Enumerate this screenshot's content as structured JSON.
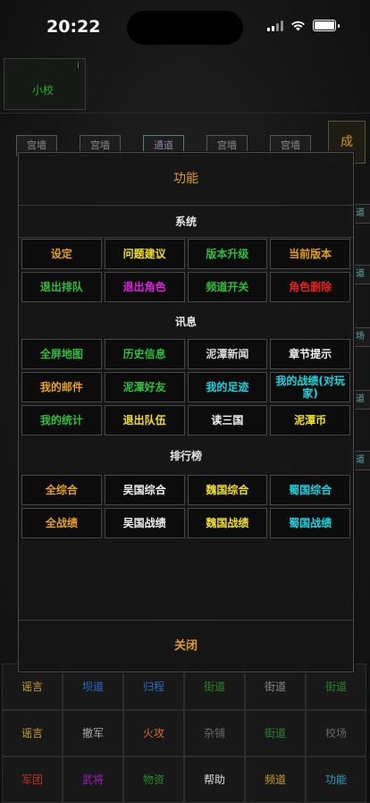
{
  "status": {
    "time": "20:22"
  },
  "player": {
    "name": "小校",
    "info": "i"
  },
  "roads": [
    "宫墙",
    "宫墙",
    "通道",
    "宫墙",
    "宫墙"
  ],
  "corner": "成",
  "side_right": [
    "道",
    "道",
    "场",
    "道",
    "道"
  ],
  "modal": {
    "title": "功能",
    "sections": [
      {
        "label": "系统",
        "buttons": [
          {
            "label": "设定",
            "color": "#e6a21a"
          },
          {
            "label": "问题建议",
            "color": "#f0e020"
          },
          {
            "label": "版本升级",
            "color": "#2fbf3a"
          },
          {
            "label": "当前版本",
            "color": "#e6a21a"
          },
          {
            "label": "退出排队",
            "color": "#2fbf3a"
          },
          {
            "label": "退出角色",
            "color": "#e020e0"
          },
          {
            "label": "频道开关",
            "color": "#2fbf3a"
          },
          {
            "label": "角色删除",
            "color": "#e82020"
          }
        ]
      },
      {
        "label": "讯息",
        "buttons": [
          {
            "label": "全屏地图",
            "color": "#2fbf3a"
          },
          {
            "label": "历史信息",
            "color": "#2fbf3a"
          },
          {
            "label": "泥潭新闻",
            "color": "#d8d8d8"
          },
          {
            "label": "章节提示",
            "color": "#f0f0f0"
          },
          {
            "label": "我的邮件",
            "color": "#e6a21a"
          },
          {
            "label": "泥潭好友",
            "color": "#2fbf3a"
          },
          {
            "label": "我的足迹",
            "color": "#18d6e0"
          },
          {
            "label": "我的战绩(对玩家)",
            "color": "#18d6e0"
          },
          {
            "label": "我的统计",
            "color": "#2fbf3a"
          },
          {
            "label": "退出队伍",
            "color": "#f0e020"
          },
          {
            "label": "读三国",
            "color": "#f0f0f0"
          },
          {
            "label": "泥潭币",
            "color": "#f0e020"
          }
        ]
      },
      {
        "label": "排行榜",
        "buttons": [
          {
            "label": "全综合",
            "color": "#e6a21a"
          },
          {
            "label": "吴国综合",
            "color": "#f0f0f0"
          },
          {
            "label": "魏国综合",
            "color": "#f0e020"
          },
          {
            "label": "蜀国综合",
            "color": "#18d6e0"
          },
          {
            "label": "全战绩",
            "color": "#e6a21a"
          },
          {
            "label": "吴国战绩",
            "color": "#f0f0f0"
          },
          {
            "label": "魏国战绩",
            "color": "#f0e020"
          },
          {
            "label": "蜀国战绩",
            "color": "#18d6e0"
          }
        ]
      }
    ],
    "close_label": "关闭"
  },
  "bottom": {
    "row1": [
      {
        "label": "谣言",
        "color": "#c8a020"
      },
      {
        "label": "坝道",
        "color": "#2a6acc"
      },
      {
        "label": "归程",
        "color": "#2a6acc"
      },
      {
        "label": "街道",
        "color": "#2a8a2a"
      },
      {
        "label": "街道",
        "color": "#888888"
      },
      {
        "label": "街道",
        "color": "#2a8a2a"
      }
    ],
    "row2": [
      {
        "label": "谣言",
        "color": "#c8a020"
      },
      {
        "label": "撤军",
        "color": "#aaaaaa"
      },
      {
        "label": "火攻",
        "color": "#d07020"
      },
      {
        "label": "杂铺",
        "color": "#666666"
      },
      {
        "label": "街道",
        "color": "#2a8a2a"
      },
      {
        "label": "校场",
        "color": "#666666"
      }
    ],
    "row3": [
      {
        "label": "军团",
        "color": "#c03020"
      },
      {
        "label": "武将",
        "color": "#a020c0"
      },
      {
        "label": "物资",
        "color": "#2a8a2a"
      },
      {
        "label": "帮助",
        "color": "#dddddd"
      },
      {
        "label": "频道",
        "color": "#c8a020"
      },
      {
        "label": "功能",
        "color": "#2aa0c0"
      }
    ]
  }
}
